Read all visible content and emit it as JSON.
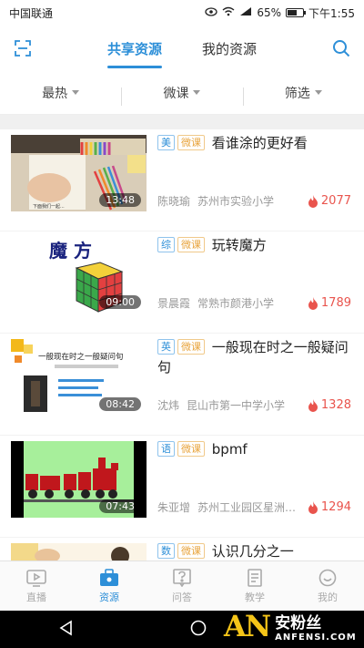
{
  "status": {
    "carrier": "中国联通",
    "battery": "65%",
    "time": "下午1:55",
    "battery_level": 0.65
  },
  "topnav": {
    "tabs": [
      {
        "label": "共享资源",
        "active": true
      },
      {
        "label": "我的资源",
        "active": false
      }
    ],
    "left_icon": "scan-icon",
    "right_icon": "search-icon"
  },
  "filters": [
    {
      "label": "最热"
    },
    {
      "label": "微课"
    },
    {
      "label": "筛选"
    }
  ],
  "items": [
    {
      "subject": "美",
      "kind": "微课",
      "title": "看谁涂的更好看",
      "teacher": "陈晓瑜",
      "school": "苏州市实验小学",
      "views": "2077",
      "duration": "13:48"
    },
    {
      "subject": "综",
      "kind": "微课",
      "title": "玩转魔方",
      "teacher": "景晨霞",
      "school": "常熟市颜港小学",
      "views": "1789",
      "duration": "09:00",
      "thumb_text": "魔  方"
    },
    {
      "subject": "英",
      "kind": "微课",
      "title": "一般现在时之一般疑问句",
      "teacher": "沈炜",
      "school": "昆山市第一中学小学",
      "views": "1328",
      "duration": "08:42",
      "thumb_text": "一般现在时之一般疑问句"
    },
    {
      "subject": "语",
      "kind": "微课",
      "title": "bpmf",
      "teacher": "朱亚增",
      "school": "苏州工业园区星洲学…",
      "views": "1294",
      "duration": "07:43"
    },
    {
      "subject": "数",
      "kind": "微课",
      "title": "认识几分之一",
      "teacher": "",
      "school": "",
      "views": "",
      "duration": ""
    }
  ],
  "tabbar": [
    {
      "label": "直播",
      "icon": "live-icon",
      "active": false
    },
    {
      "label": "资源",
      "icon": "resource-icon",
      "active": true
    },
    {
      "label": "问答",
      "icon": "qa-icon",
      "active": false
    },
    {
      "label": "教学",
      "icon": "teaching-icon",
      "active": false
    },
    {
      "label": "我的",
      "icon": "profile-icon",
      "active": false
    }
  ],
  "watermark": {
    "logo": "AN",
    "cn": "安粉丝",
    "en": "ANFENSI.COM"
  },
  "colors": {
    "accent": "#2d8fd8",
    "hot": "#e9544d",
    "tag_kind": "#e8a43d"
  }
}
